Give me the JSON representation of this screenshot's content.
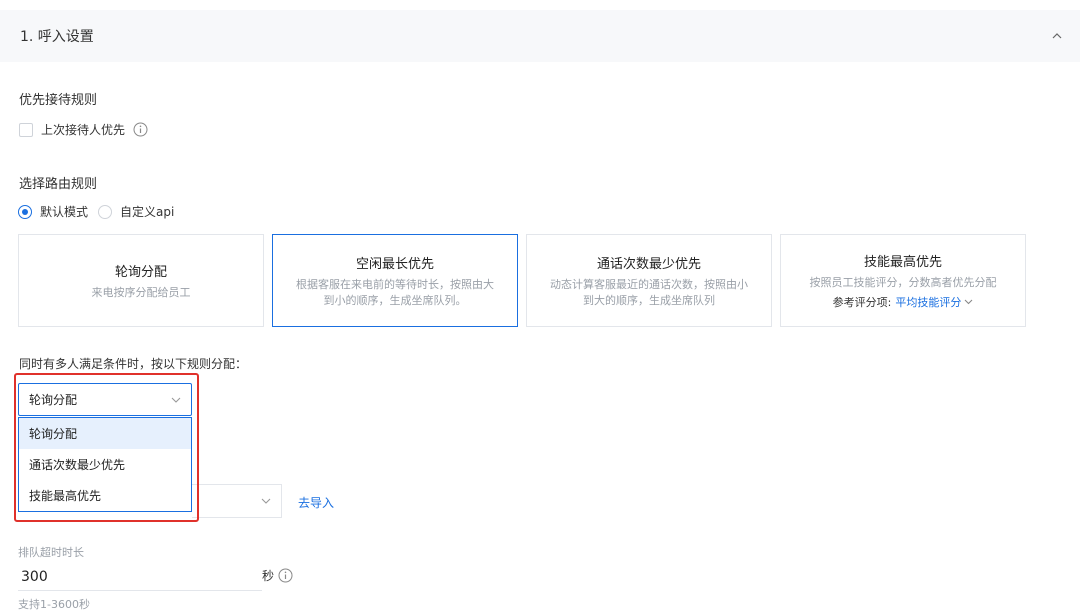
{
  "section": {
    "title": "1. 呼入设置"
  },
  "priority_rule": {
    "heading": "优先接待规则",
    "checkbox_label": "上次接待人优先"
  },
  "routing": {
    "heading": "选择路由规则",
    "modes": [
      {
        "label": "默认模式",
        "checked": true
      },
      {
        "label": "自定义api",
        "checked": false
      }
    ],
    "cards": [
      {
        "title": "轮询分配",
        "desc": "来电按序分配给员工",
        "selected": false
      },
      {
        "title": "空闲最长优先",
        "desc": "根据客服在来电前的等待时长，按照由大到小的顺序，生成坐席队列。",
        "selected": true
      },
      {
        "title": "通话次数最少优先",
        "desc": "动态计算客服最近的通话次数，按照由小到大的顺序，生成坐席队列",
        "selected": false
      },
      {
        "title": "技能最高优先",
        "desc": "按照员工技能评分，分数高者优先分配",
        "ref_label": "参考评分项:",
        "ref_value": "平均技能评分",
        "selected": false
      }
    ]
  },
  "tie_break": {
    "label": "同时有多人满足条件时，按以下规则分配：",
    "selected": "轮询分配",
    "options": [
      "轮询分配",
      "通话次数最少优先",
      "技能最高优先"
    ]
  },
  "import": {
    "link": "去导入"
  },
  "queue_timeout": {
    "label": "排队超时时长",
    "value": "300",
    "unit": "秒",
    "hint": "支持1-3600秒"
  },
  "colors": {
    "accent": "#1a6fe0",
    "highlight": "#e0312b",
    "selected_bg": "#e6f0fd"
  }
}
